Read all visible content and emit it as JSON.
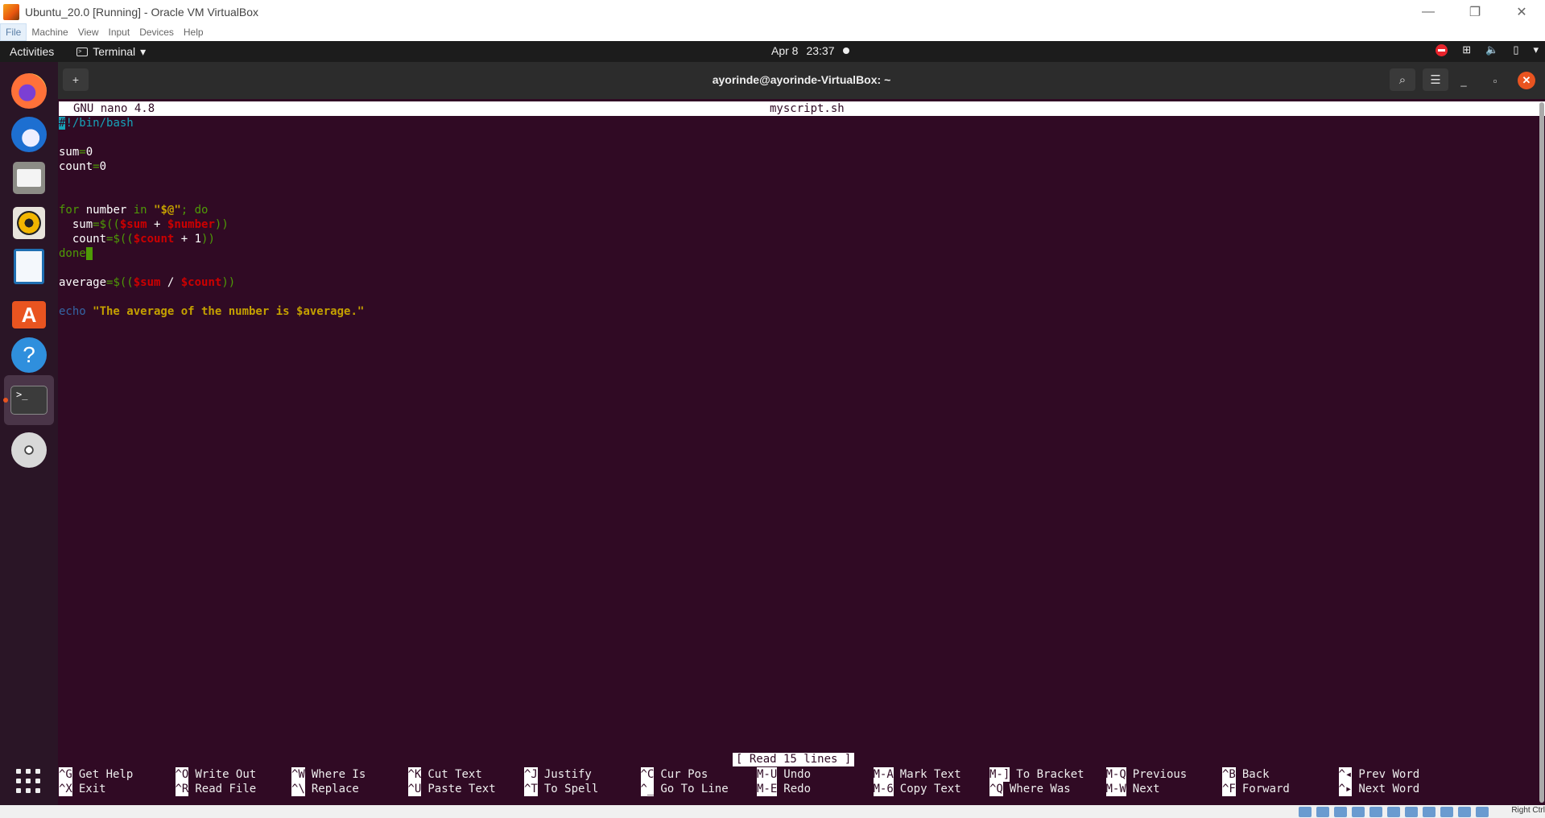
{
  "host_window": {
    "title": "Ubuntu_20.0 [Running] - Oracle VM VirtualBox",
    "menu": [
      "File",
      "Machine",
      "View",
      "Input",
      "Devices",
      "Help"
    ],
    "controls": {
      "minimize": "—",
      "restore": "❐",
      "close": "✕"
    },
    "status_hint": "Right Ctrl"
  },
  "topbar": {
    "activities": "Activities",
    "app_name": "Terminal",
    "app_menu_arrow": "▾",
    "date": "Apr 8",
    "time": "23:37",
    "tray_icons": [
      "do-not-disturb-icon",
      "network-icon",
      "volume-icon",
      "battery-icon",
      "system-menu-arrow-icon"
    ]
  },
  "dock": {
    "items": [
      {
        "name": "firefox",
        "label": "Firefox"
      },
      {
        "name": "thunderbird",
        "label": "Thunderbird"
      },
      {
        "name": "files",
        "label": "Files"
      },
      {
        "name": "rhythmbox",
        "label": "Rhythmbox"
      },
      {
        "name": "libreoffice-writer",
        "label": "LibreOffice Writer"
      },
      {
        "name": "ubuntu-software",
        "label": "Ubuntu Software"
      },
      {
        "name": "help",
        "label": "Help"
      },
      {
        "name": "terminal",
        "label": "Terminal",
        "active": true
      },
      {
        "name": "dvd",
        "label": "DVD"
      }
    ],
    "show_apps": "Show Applications"
  },
  "terminal": {
    "title": "ayorinde@ayorinde-VirtualBox: ~",
    "new_tab_glyph": "+",
    "search_glyph": "⌕",
    "menu_glyph": "☰",
    "min_glyph": "_",
    "max_glyph": "▫",
    "close_glyph": "✕"
  },
  "nano": {
    "version": "GNU nano 4.8",
    "filename": "myscript.sh",
    "code": {
      "l1_hash": "#",
      "l1_rest": "!/bin/bash",
      "l3_var": "sum",
      "l3_eq": "=",
      "l3_val": "0",
      "l4_var": "count",
      "l4_eq": "=",
      "l4_val": "0",
      "l7_for": "for",
      "l7_var": " number ",
      "l7_in": "in",
      "l7_sp": " ",
      "l7_q1": "\"",
      "l7_args": "$@",
      "l7_q2": "\"",
      "l7_semi": "; do",
      "l8_indent": "  ",
      "l8_var": "sum",
      "l8_op": "=$((",
      "l8_v1": "$sum",
      "l8_plus": " + ",
      "l8_v2": "$number",
      "l8_close": "))",
      "l9_indent": "  ",
      "l9_var": "count",
      "l9_op": "=$((",
      "l9_v1": "$count",
      "l9_plus": " + 1",
      "l9_close": "))",
      "l10_done": "done",
      "l12_var": "average",
      "l12_op": "=$((",
      "l12_v1": "$sum",
      "l12_div": " / ",
      "l12_v2": "$count",
      "l12_close": "))",
      "l14_echo": "echo",
      "l14_str": " \"The average of the number is $average.\""
    },
    "status": "[ Read 15 lines ]",
    "shortcuts_row1": [
      {
        "key": "^G",
        "label": "Get Help"
      },
      {
        "key": "^O",
        "label": "Write Out"
      },
      {
        "key": "^W",
        "label": "Where Is"
      },
      {
        "key": "^K",
        "label": "Cut Text"
      },
      {
        "key": "^J",
        "label": "Justify"
      },
      {
        "key": "^C",
        "label": "Cur Pos"
      },
      {
        "key": "M-U",
        "label": "Undo"
      },
      {
        "key": "M-A",
        "label": "Mark Text"
      },
      {
        "key": "M-]",
        "label": "To Bracket"
      },
      {
        "key": "M-Q",
        "label": "Previous"
      },
      {
        "key": "^B",
        "label": "Back"
      },
      {
        "key": "^◂",
        "label": "Prev Word"
      }
    ],
    "shortcuts_row2": [
      {
        "key": "^X",
        "label": "Exit"
      },
      {
        "key": "^R",
        "label": "Read File"
      },
      {
        "key": "^\\",
        "label": "Replace"
      },
      {
        "key": "^U",
        "label": "Paste Text"
      },
      {
        "key": "^T",
        "label": "To Spell"
      },
      {
        "key": "^_",
        "label": "Go To Line"
      },
      {
        "key": "M-E",
        "label": "Redo"
      },
      {
        "key": "M-6",
        "label": "Copy Text"
      },
      {
        "key": "^Q",
        "label": "Where Was"
      },
      {
        "key": "M-W",
        "label": "Next"
      },
      {
        "key": "^F",
        "label": "Forward"
      },
      {
        "key": "^▸",
        "label": "Next Word"
      }
    ]
  }
}
